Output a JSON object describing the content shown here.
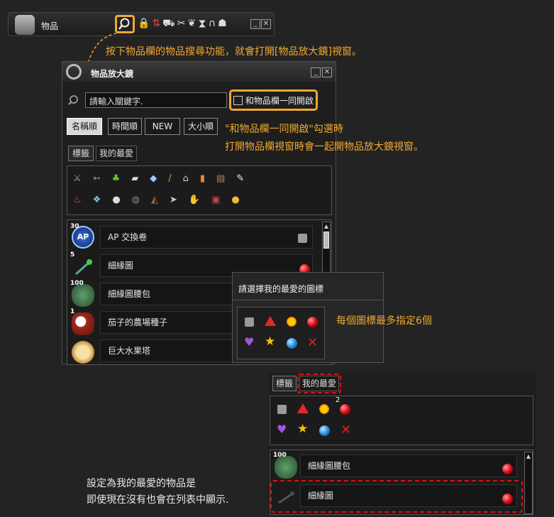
{
  "inventory_bar": {
    "title": "物品"
  },
  "notes": {
    "search_hint": "按下物品欄的物品搜尋功能，就會打開[物品放大鏡]視窗。",
    "checkbox_hint_1": "\"和物品欄一同開啟\"勾選時",
    "checkbox_hint_2": "打開物品欄視窗時會一起開物品放大鏡視窗。",
    "max_icons": "每個圖標最多指定6個",
    "fav_hint_1": "設定為我的最愛的物品是",
    "fav_hint_2": "即使現在沒有也會在列表中顯示."
  },
  "magnifier": {
    "title": "物品放大鏡",
    "search_placeholder": "請輸入關鍵字.",
    "open_with_inventory": "和物品欄一同開啟",
    "sort_buttons": [
      "名稱順",
      "時間順",
      "NEW",
      "大小順"
    ],
    "tabs": [
      "標籤",
      "我的最愛"
    ],
    "items": [
      {
        "count": "30",
        "name": "AP 交換卷",
        "icon_name": "ap-coupon-icon",
        "marker": "gray-square"
      },
      {
        "count": "5",
        "name": "細緣圖",
        "icon_name": "green-stick-icon",
        "marker": "red-gem"
      },
      {
        "count": "100",
        "name": "細緣圖腰包",
        "icon_name": "pouch-icon",
        "marker": ""
      },
      {
        "count": "1",
        "name": "茄子的農場種子",
        "icon_name": "seed-icon",
        "marker": ""
      },
      {
        "count": "",
        "name": "巨大水果塔",
        "icon_name": "fruit-tart-icon",
        "marker": ""
      }
    ]
  },
  "popup": {
    "title": "請選擇我的最愛的圖標"
  },
  "fav_panel": {
    "tabs": [
      "標籤",
      "我的最愛"
    ],
    "red_gem_count": "2",
    "items": [
      {
        "count": "100",
        "name": "細緣圖腰包",
        "icon_name": "pouch-icon"
      },
      {
        "count": "",
        "name": "細緣圖",
        "icon_name": "green-stick-icon"
      }
    ]
  },
  "colors": {
    "accent": "#f0a830",
    "highlight_red": "#e01010",
    "bg": "#232323"
  }
}
